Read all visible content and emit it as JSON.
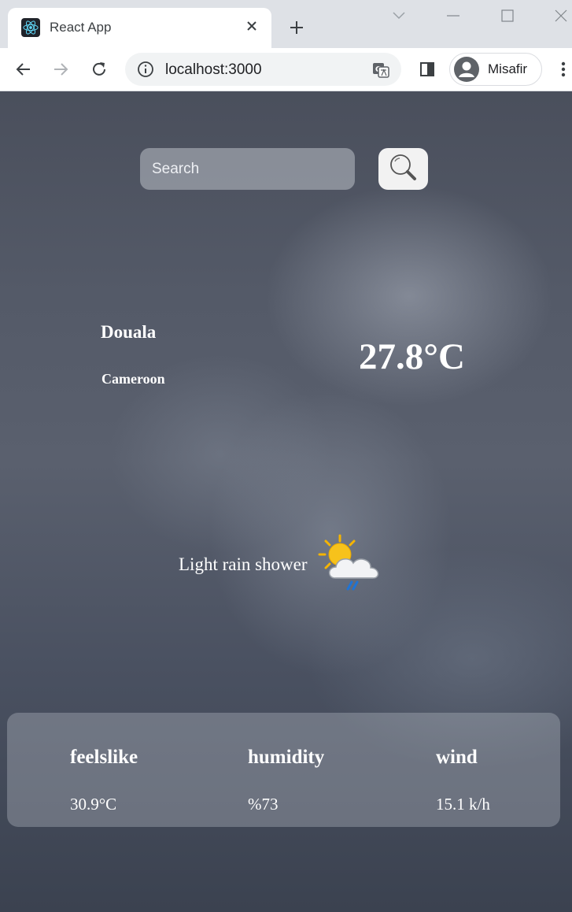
{
  "browser": {
    "tab_title": "React App",
    "url": "localhost:3000",
    "profile_name": "Misafir"
  },
  "search": {
    "placeholder": "Search"
  },
  "location": {
    "city": "Douala",
    "country": "Cameroon"
  },
  "weather": {
    "temperature": "27.8°C",
    "condition": "Light rain shower",
    "condition_icon": "sun-cloud-rain-icon"
  },
  "details": [
    {
      "label": "feelslike",
      "value": "30.9°C"
    },
    {
      "label": "humidity",
      "value": "%73"
    },
    {
      "label": "wind",
      "value": "15.1 k/h"
    }
  ]
}
